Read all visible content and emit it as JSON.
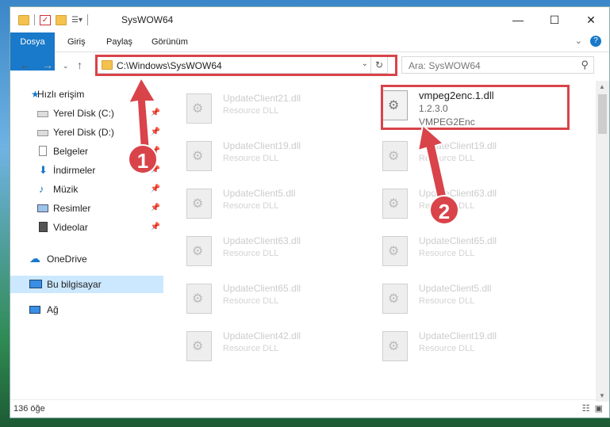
{
  "window": {
    "title": "SysWOW64"
  },
  "ribbon": {
    "tabs": [
      "Dosya",
      "Giriş",
      "Paylaş",
      "Görünüm"
    ]
  },
  "nav": {
    "address": "C:\\Windows\\SysWOW64",
    "search_placeholder": "Ara: SysWOW64"
  },
  "sidebar": {
    "items": [
      {
        "label": "Hızlı erişim",
        "icon": "star-icon"
      },
      {
        "label": "Yerel Disk (C:)",
        "icon": "drive-icon"
      },
      {
        "label": "Yerel Disk (D:)",
        "icon": "drive-icon"
      },
      {
        "label": "Belgeler",
        "icon": "documents-icon"
      },
      {
        "label": "İndirmeler",
        "icon": "download-icon"
      },
      {
        "label": "Müzik",
        "icon": "music-icon"
      },
      {
        "label": "Resimler",
        "icon": "pictures-icon"
      },
      {
        "label": "Videolar",
        "icon": "videos-icon"
      },
      {
        "label": "OneDrive",
        "icon": "cloud-icon"
      },
      {
        "label": "Bu bilgisayar",
        "icon": "computer-icon"
      },
      {
        "label": "Ağ",
        "icon": "network-icon"
      }
    ]
  },
  "files": {
    "left": [
      {
        "name": "UpdateClient21.dll",
        "desc": "Resource DLL"
      },
      {
        "name": "UpdateClient19.dll",
        "desc": "Resource DLL"
      },
      {
        "name": "UpdateClient5.dll",
        "desc": "Resource DLL"
      },
      {
        "name": "UpdateClient63.dll",
        "desc": "Resource DLL"
      },
      {
        "name": "UpdateClient65.dll",
        "desc": "Resource DLL"
      },
      {
        "name": "UpdateClient42.dll",
        "desc": "Resource DLL"
      }
    ],
    "focus": {
      "name": "vmpeg2enc.1.dll",
      "version": "1.2.3.0",
      "desc": "VMPEG2Enc"
    },
    "right": [
      {
        "name": "UpdateClient19.dll",
        "desc": "Resource DLL"
      },
      {
        "name": "UpdateClient63.dll",
        "desc": "Resource DLL"
      },
      {
        "name": "UpdateClient65.dll",
        "desc": "Resource DLL"
      },
      {
        "name": "UpdateClient5.dll",
        "desc": "Resource DLL"
      },
      {
        "name": "UpdateClient19.dll",
        "desc": "Resource DLL"
      }
    ]
  },
  "status": {
    "count": "136 öğe"
  },
  "annotations": {
    "step1": "1",
    "step2": "2",
    "color": "#d9434a"
  }
}
